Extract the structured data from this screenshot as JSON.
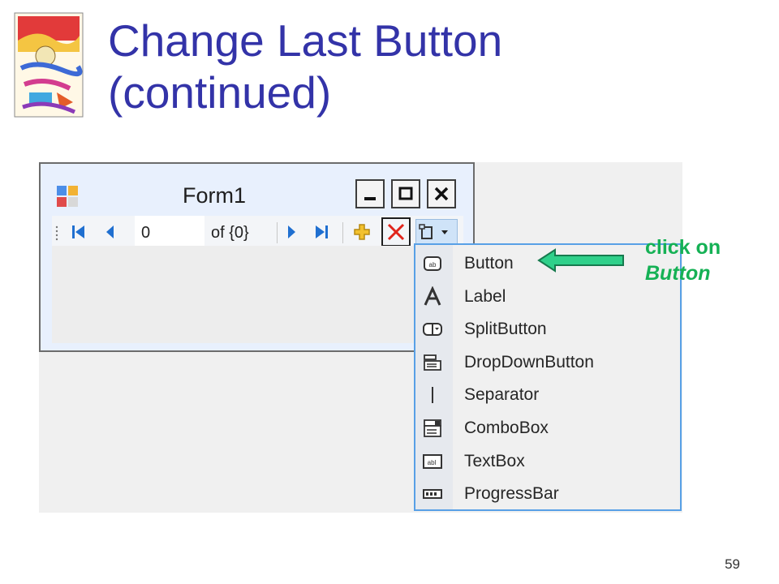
{
  "slide": {
    "title_line1": "Change Last Button",
    "title_line2": "(continued)",
    "page_number": "59"
  },
  "form": {
    "title": "Form1",
    "icon": "form-app-icon",
    "window_buttons": [
      "minimize-icon",
      "maximize-icon",
      "close-icon"
    ]
  },
  "navigator": {
    "position_value": "0",
    "count_label": "of {0}",
    "buttons": [
      "move-first-icon",
      "move-previous-icon",
      "move-next-icon",
      "move-last-icon",
      "add-new-icon",
      "delete-icon",
      "add-item-dropdown-icon"
    ]
  },
  "menu": {
    "items": [
      {
        "label": "Button",
        "icon": "button-icon"
      },
      {
        "label": "Label",
        "icon": "label-icon"
      },
      {
        "label": "SplitButton",
        "icon": "split-button-icon"
      },
      {
        "label": "DropDownButton",
        "icon": "dropdown-button-icon"
      },
      {
        "label": "Separator",
        "icon": "separator-icon"
      },
      {
        "label": "ComboBox",
        "icon": "combobox-icon"
      },
      {
        "label": "TextBox",
        "icon": "textbox-icon"
      },
      {
        "label": "ProgressBar",
        "icon": "progressbar-icon"
      }
    ]
  },
  "annotation": {
    "line1": "click on",
    "line2": "Button",
    "color": "#15b155"
  },
  "colors": {
    "title": "#3333a8",
    "menu_border": "#58a0e6",
    "arrow_fill": "#2fd08a"
  }
}
